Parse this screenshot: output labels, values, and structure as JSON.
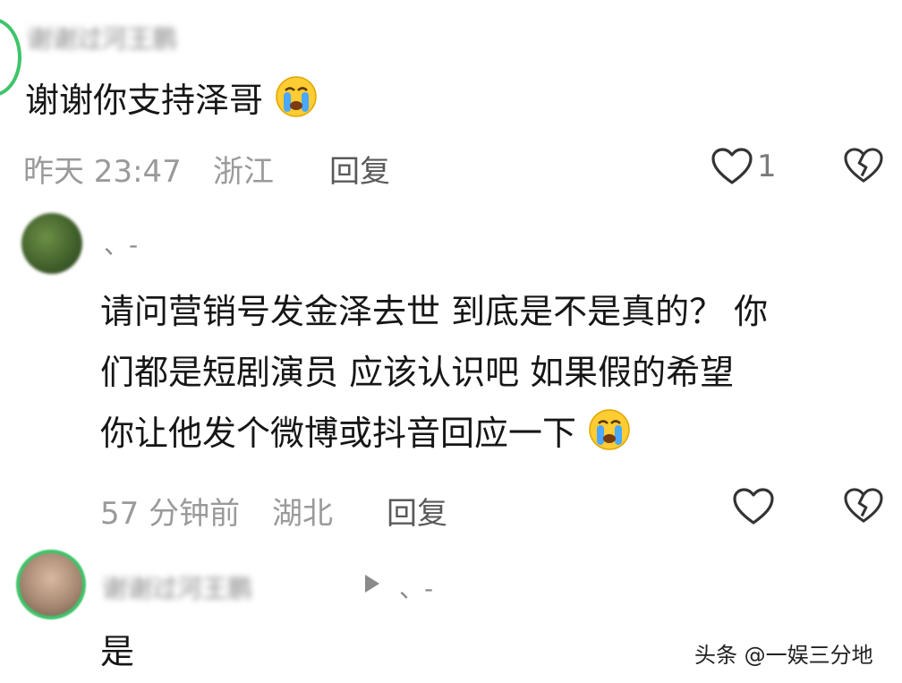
{
  "comments": [
    {
      "author": "谢谢过河王鹏",
      "text": "谢谢你支持泽哥",
      "time": "昨天 23:47",
      "location": "浙江",
      "reply_label": "回复",
      "likes": "1"
    },
    {
      "author": "、-",
      "text_lines": [
        "请问营销号发金泽去世 到底是不是真的？ 你",
        "们都是短剧演员 应该认识吧 如果假的希望",
        "你让他发个微博或抖音回应一下"
      ],
      "time": "57 分钟前",
      "location": "湖北",
      "reply_label": "回复"
    },
    {
      "author": "谢谢过河王鹏",
      "reply_to": "、-",
      "text": "是"
    }
  ],
  "watermark": "头条 @一娱三分地",
  "colors": {
    "text": "#161616",
    "meta": "#9a9a9a",
    "icon": "#333333",
    "avatar_ring": "#3fc46a"
  }
}
